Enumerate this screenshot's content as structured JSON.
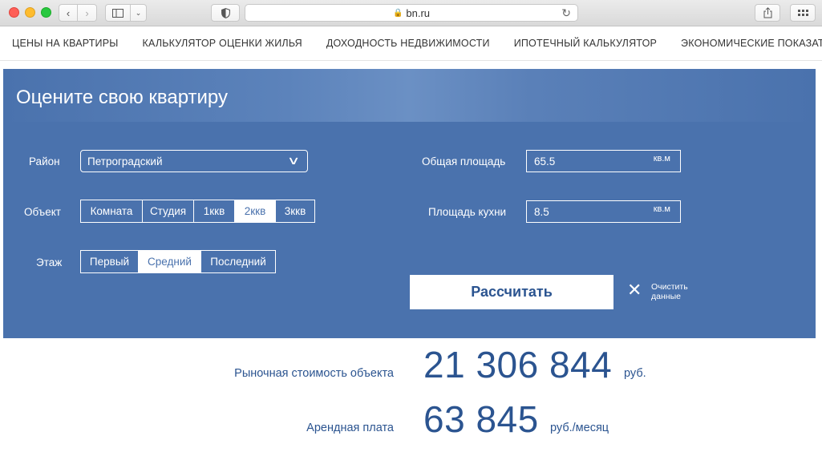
{
  "browser": {
    "url": "bn.ru"
  },
  "nav": {
    "items": [
      "ЦЕНЫ НА КВАРТИРЫ",
      "КАЛЬКУЛЯТОР ОЦЕНКИ ЖИЛЬЯ",
      "ДОХОДНОСТЬ НЕДВИЖИМОСТИ",
      "ИПОТЕЧНЫЙ КАЛЬКУЛЯТОР",
      "ЭКОНОМИЧЕСКИЕ ПОКАЗАТЕЛИ РФ"
    ]
  },
  "calculator": {
    "title": "Оцените свою квартиру",
    "district": {
      "label": "Район",
      "value": "Петроградский"
    },
    "object": {
      "label": "Объект",
      "options": [
        "Комната",
        "Студия",
        "1ккв",
        "2ккв",
        "3ккв"
      ],
      "selected": "2ккв"
    },
    "floor": {
      "label": "Этаж",
      "options": [
        "Первый",
        "Средний",
        "Последний"
      ],
      "selected": "Средний"
    },
    "total_area": {
      "label": "Общая площадь",
      "value": "65.5",
      "unit": "кв.м"
    },
    "kitchen_area": {
      "label": "Площадь кухни",
      "value": "8.5",
      "unit": "кв.м"
    },
    "calculate_label": "Рассчитать",
    "clear_label": "Очистить данные"
  },
  "results": {
    "market_value": {
      "label": "Рыночная стоимость объекта",
      "value": "21 306 844",
      "unit": "руб."
    },
    "rent": {
      "label": "Арендная плата",
      "value": "63 845",
      "unit": "руб./месяц"
    }
  },
  "colors": {
    "panel": "#4a72ad",
    "accent_text": "#2b5490"
  }
}
